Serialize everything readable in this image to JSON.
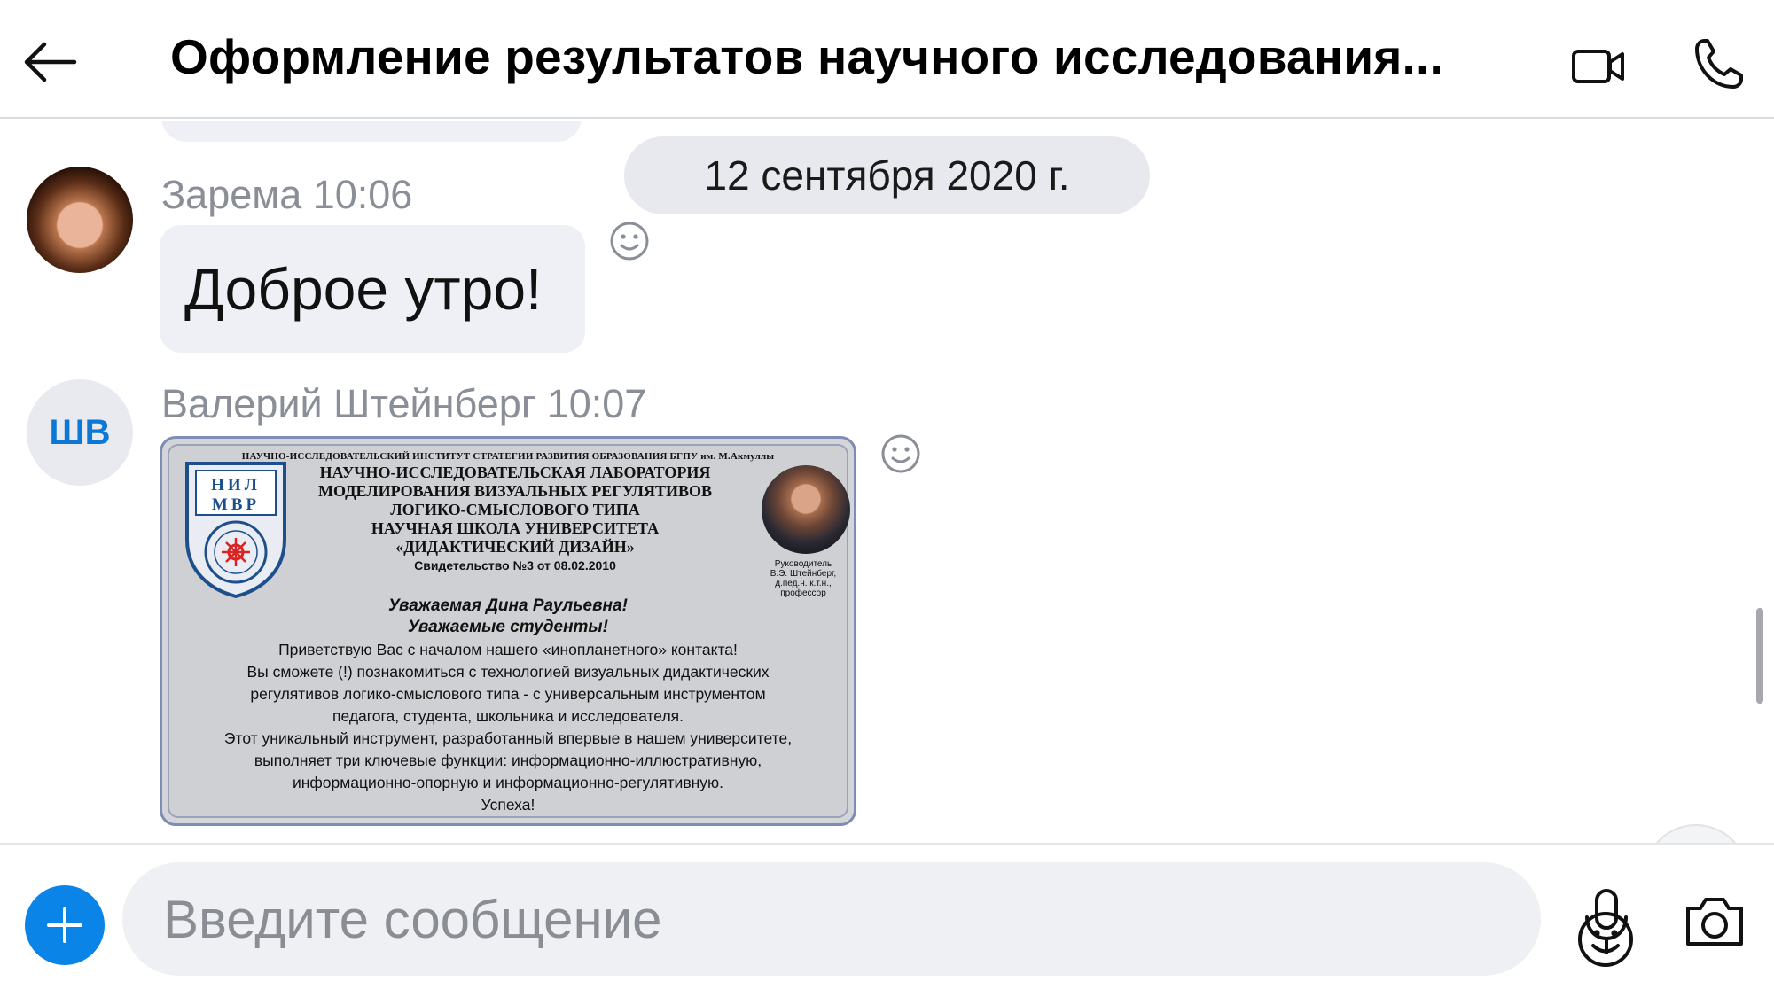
{
  "header": {
    "title": "Оформление результатов научного исследования...",
    "back_icon": "arrow-left-icon",
    "video_icon": "video-camera-icon",
    "call_icon": "phone-icon"
  },
  "chat": {
    "date_separator": "12 сентября 2020 г.",
    "messages": [
      {
        "sender": "Зарема",
        "time": "10:06",
        "sender_line": "Зарема 10:06",
        "text": "Доброе утро!",
        "avatar": "photo"
      },
      {
        "sender": "Валерий Штейнберг",
        "time": "10:07",
        "sender_line": "Валерий Штейнберг 10:07",
        "avatar_initials": "ШВ",
        "image": {
          "top_line": "НАУЧНО-ИССЛЕДОВАТЕЛЬСКИЙ ИНСТИТУТ СТРАТЕГИИ РАЗВИТИЯ ОБРАЗОВАНИЯ БГПУ им. М.Акмуллы",
          "logo_text": "НИЛ МВР",
          "heading_lines": [
            "НАУЧНО-ИССЛЕДОВАТЕЛЬСКАЯ ЛАБОРАТОРИЯ",
            "МОДЕЛИРОВАНИЯ ВИЗУАЛЬНЫХ РЕГУЛЯТИВОВ",
            "ЛОГИКО-СМЫСЛОВОГО ТИПА",
            "НАУЧНАЯ ШКОЛА УНИВЕРСИТЕТА",
            "«ДИДАКТИЧЕСКИЙ ДИЗАЙН»"
          ],
          "certificate": "Свидетельство №3 от 08.02.2010",
          "portrait_caption_lines": [
            "Руководитель",
            "В.Э. Штейнберг,",
            "д.пед.н. к.т.н.,",
            "профессор"
          ],
          "greeting_lines": [
            "Уважаемая Дина Раульевна!",
            "Уважаемые студенты!"
          ],
          "body_lines": [
            "Приветствую Вас с началом нашего «инопланетного» контакта!",
            "Вы сможете (!) познакомиться с технологией визуальных дидактических",
            "регулятивов логико-смыслового типа - с универсальным инструментом",
            "педагога, студента, школьника и исследователя.",
            "Этот уникальный инструмент, разработанный впервые в нашем университете,",
            "выполняет три ключевые функции: информационно-иллюстративную,",
            "информационно-опорную и информационно-регулятивную.",
            "Успеха!"
          ]
        }
      }
    ]
  },
  "composer": {
    "placeholder": "Введите сообщение",
    "value": "",
    "plus_icon": "plus-icon",
    "emoji_icon": "emoji-icon",
    "mic_icon": "microphone-icon",
    "camera_icon": "camera-icon"
  },
  "colors": {
    "accent": "#0b84e8",
    "initials": "#0b78d6",
    "bubble": "#eef0f5",
    "muted_text": "#8a8e96"
  }
}
